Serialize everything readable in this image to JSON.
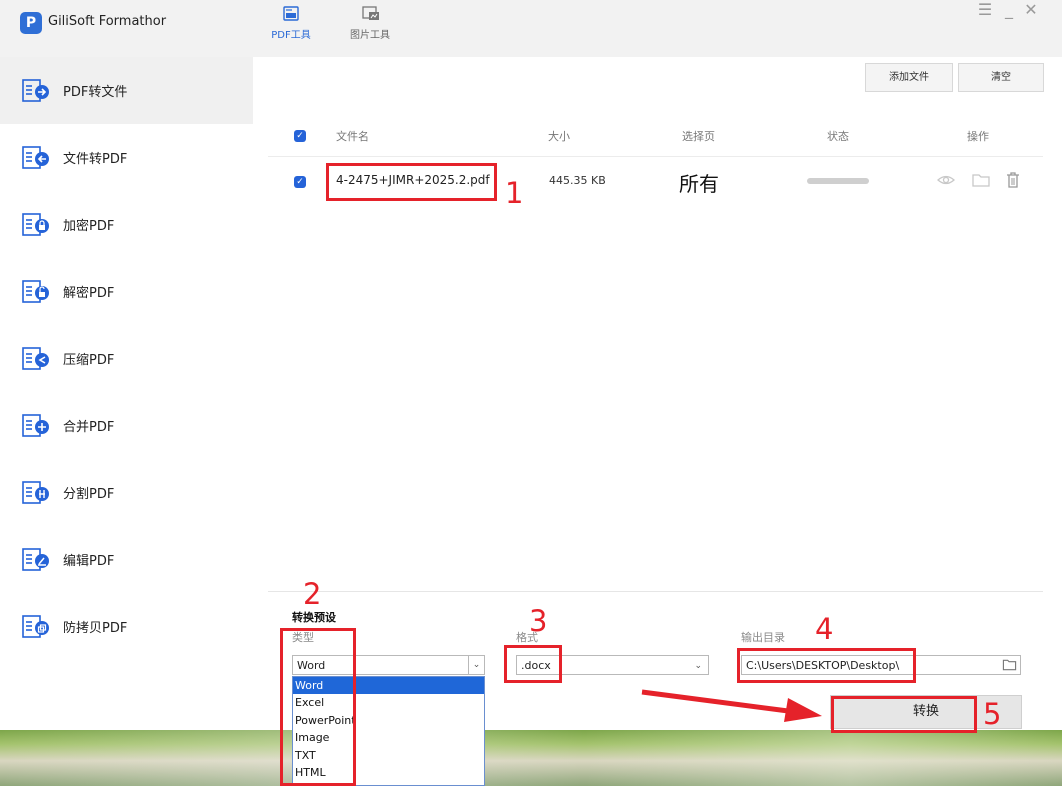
{
  "app": {
    "title": "GiliSoft Formathor",
    "logo_letter": "P"
  },
  "top_tabs": [
    {
      "label": "PDF工具",
      "icon": "pdf-tool-icon",
      "active": true
    },
    {
      "label": "图片工具",
      "icon": "image-tool-icon",
      "active": false
    }
  ],
  "window_controls": [
    "menu-icon",
    "minimize-icon",
    "close-icon"
  ],
  "sidebar": {
    "items": [
      {
        "label": "PDF转文件",
        "icon": "pdf-to-file-icon",
        "active": true
      },
      {
        "label": "文件转PDF",
        "icon": "file-to-pdf-icon"
      },
      {
        "label": "加密PDF",
        "icon": "lock-icon"
      },
      {
        "label": "解密PDF",
        "icon": "unlock-icon"
      },
      {
        "label": "压缩PDF",
        "icon": "compress-icon"
      },
      {
        "label": "合并PDF",
        "icon": "merge-icon"
      },
      {
        "label": "分割PDF",
        "icon": "split-icon"
      },
      {
        "label": "编辑PDF",
        "icon": "edit-icon"
      },
      {
        "label": "防拷贝PDF",
        "icon": "copy-protect-icon"
      }
    ]
  },
  "toolbar": {
    "add_file": "添加文件",
    "clear": "清空"
  },
  "table": {
    "headers": {
      "filename": "文件名",
      "size": "大小",
      "pages": "选择页",
      "status": "状态",
      "actions": "操作"
    },
    "rows": [
      {
        "checked": true,
        "filename": "4-2475+JIMR+2025.2.pdf",
        "size": "445.35 KB",
        "pages": "所有",
        "status_progress": 0
      }
    ]
  },
  "preset": {
    "title": "转换预设",
    "type_label": "类型",
    "type_value": "Word",
    "type_options": [
      "Word",
      "Excel",
      "PowerPoint",
      "Image",
      "TXT",
      "HTML"
    ],
    "format_label": "格式",
    "format_value": ".docx",
    "output_label": "输出目录",
    "output_value": "C:\\Users\\DESKTOP\\Desktop\\",
    "convert_label": "转换"
  },
  "annotations": [
    "1",
    "2",
    "3",
    "4",
    "5"
  ],
  "colors": {
    "accent": "#2563d8",
    "annotation_red": "#e5222a"
  }
}
